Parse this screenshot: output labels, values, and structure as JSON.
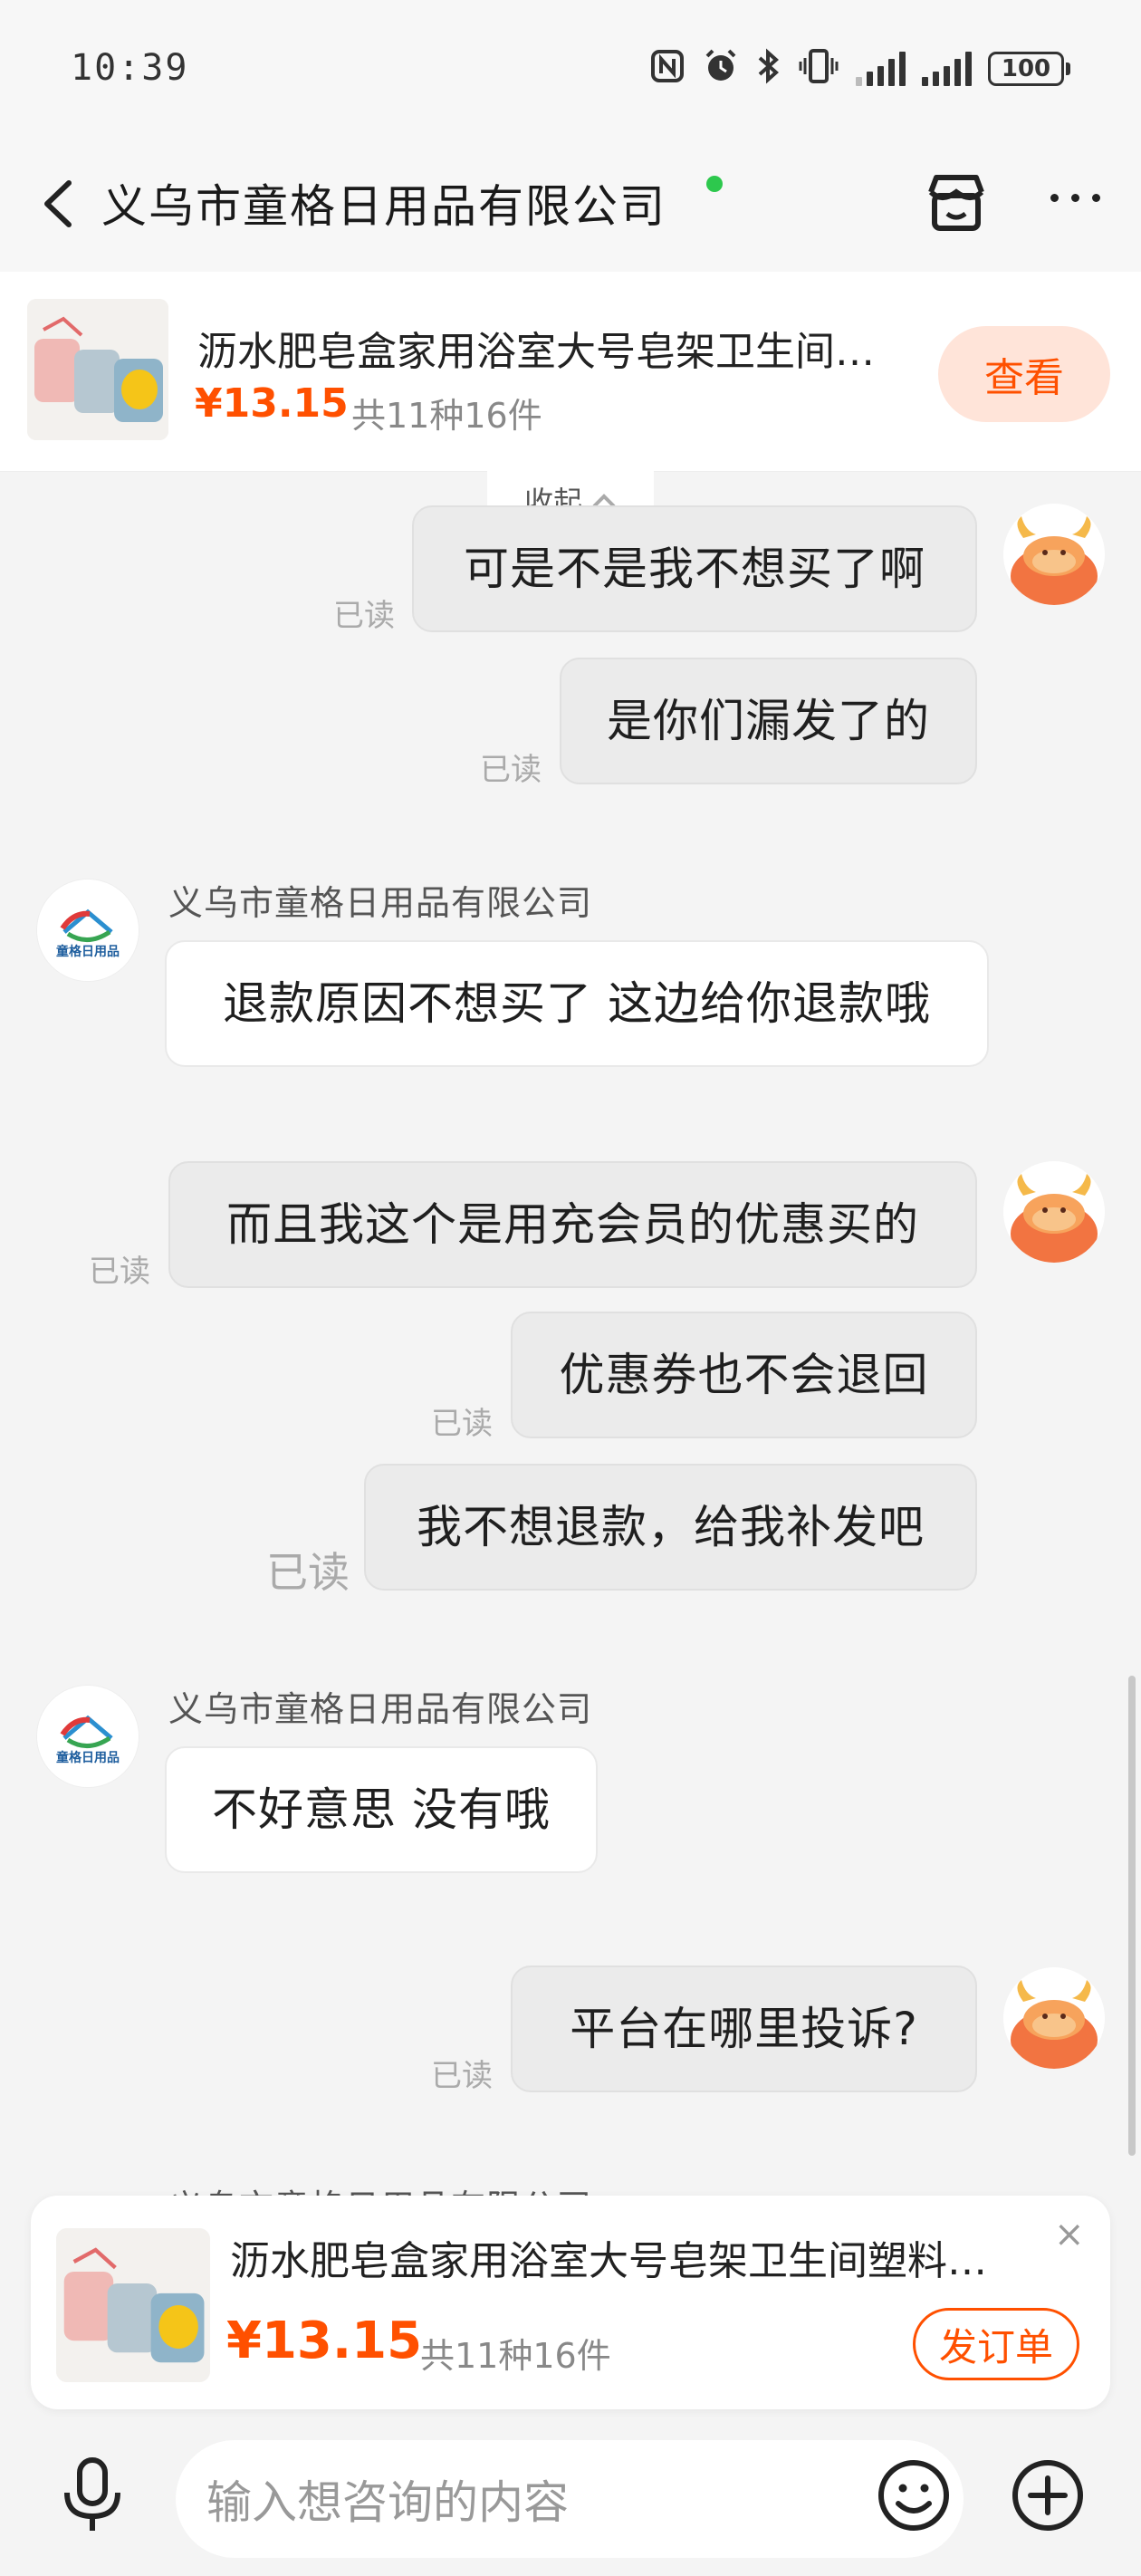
{
  "status_bar": {
    "time": "10:39",
    "battery": "100",
    "icons": [
      "nfc-icon",
      "alarm-icon",
      "bluetooth-icon",
      "vibrate-icon",
      "signal-icon",
      "signal-icon",
      "battery-icon"
    ]
  },
  "header": {
    "title": "义乌市童格日用品有限公司",
    "online_color": "#2dc84d"
  },
  "product": {
    "name": "沥水肥皂盒家用浴室大号皂架卫生间…",
    "price": "¥13.15",
    "quantity": "共11种16件",
    "view_label": "查看"
  },
  "chat": {
    "collapse_label": "收起",
    "read_label": "已读",
    "shop_name": "义乌市童格日用品有限公司",
    "shop_logo_text": "童格日用品",
    "messages": [
      {
        "from": "me",
        "text": "可是不是我不想买了啊"
      },
      {
        "from": "me",
        "text": "是你们漏发了的"
      },
      {
        "from": "shop",
        "text": "退款原因不想买了 这边给你退款哦"
      },
      {
        "from": "me",
        "text": "而且我这个是用充会员的优惠买的"
      },
      {
        "from": "me",
        "text": "优惠券也不会退回"
      },
      {
        "from": "me",
        "text": "我不想退款，给我补发吧"
      },
      {
        "from": "shop",
        "text": "不好意思 没有哦"
      },
      {
        "from": "me",
        "text": "平台在哪里投诉?"
      }
    ]
  },
  "card": {
    "name": "沥水肥皂盒家用浴室大号皂架卫生间塑料…",
    "price": "¥13.15",
    "quantity": "共11种16件",
    "button_label": "发订单",
    "close": "×"
  },
  "input": {
    "placeholder": "输入想咨询的内容"
  },
  "colors": {
    "accent": "#ff5000",
    "bubble_me": "#ebebeb",
    "bubble_shop": "#ffffff"
  }
}
